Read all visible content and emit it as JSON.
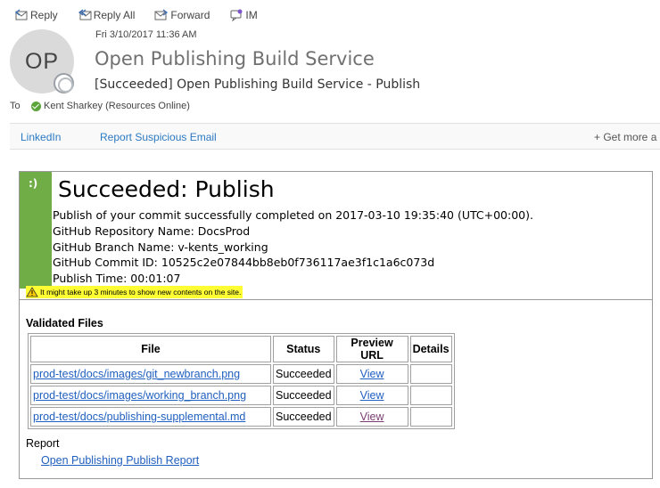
{
  "toolbar": {
    "reply": "Reply",
    "reply_all": "Reply All",
    "forward": "Forward",
    "im": "IM"
  },
  "header": {
    "avatar_initials": "OP",
    "date": "Fri 3/10/2017 11:36 AM",
    "sender": "Open Publishing Build Service",
    "subject": "[Succeeded] Open Publishing Build Service - Publish",
    "to_label": "To",
    "recipient": "Kent Sharkey (Resources Online)"
  },
  "addins": {
    "linkedin": "LinkedIn",
    "report_suspicious": "Report Suspicious Email",
    "get_more": "+ Get more a"
  },
  "body": {
    "smiley": ":)",
    "title": "Succeeded: Publish",
    "lines": {
      "commit_message": "Publish of your commit successfully completed on 2017-03-10 19:35:40 (UTC+00:00).",
      "repo": "GitHub Repository Name: DocsProd",
      "branch": "GitHub Branch Name: v-kents_working",
      "commit_id": "GitHub Commit ID: 10525c2e07844bb8eb0f736117ae3f1c1a6c073d",
      "publish_time": "Publish Time: 00:01:07"
    },
    "warning": "It might take up 3 minutes to show new contents on the site.",
    "validated_heading": "Validated Files",
    "table": {
      "headers": [
        "File",
        "Status",
        "Preview URL",
        "Details"
      ],
      "rows": [
        {
          "file": "prod-test/docs/images/git_newbranch.png",
          "status": "Succeeded",
          "preview": "View",
          "details": ""
        },
        {
          "file": "prod-test/docs/images/working_branch.png",
          "status": "Succeeded",
          "preview": "View",
          "details": ""
        },
        {
          "file": "prod-test/docs/publishing-supplemental.md",
          "status": "Succeeded",
          "preview": "View",
          "details": ""
        }
      ]
    },
    "report_label": "Report",
    "report_link": "Open Publishing Publish Report"
  }
}
